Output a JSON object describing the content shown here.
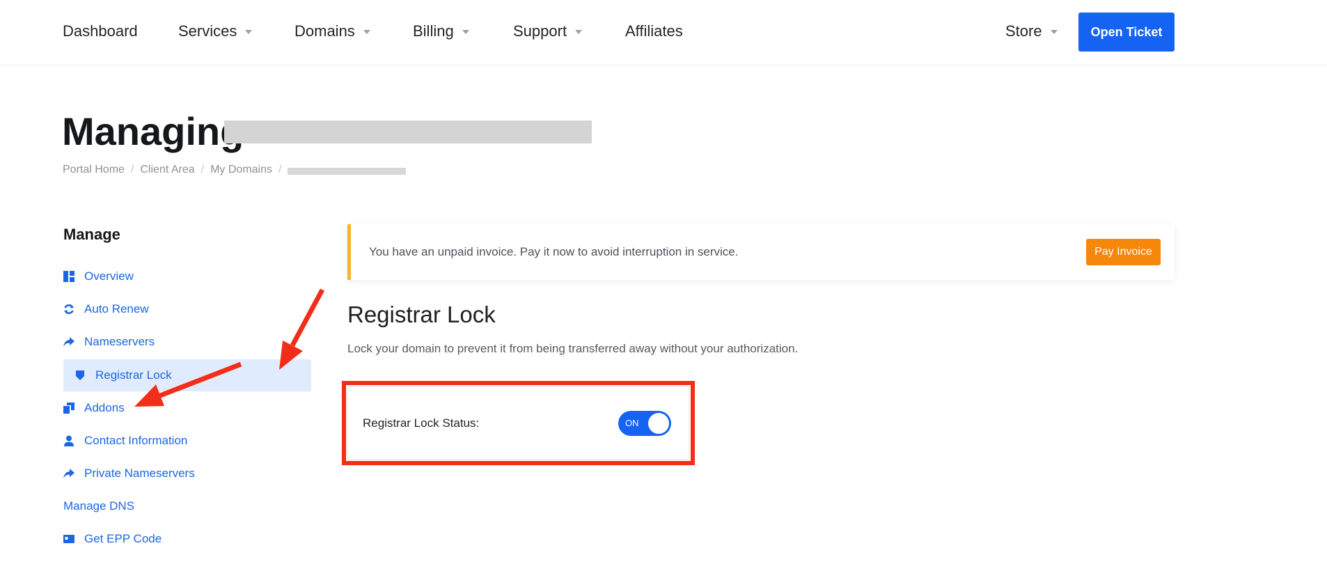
{
  "header": {
    "nav": [
      {
        "label": "Dashboard",
        "has_dropdown": false
      },
      {
        "label": "Services",
        "has_dropdown": true
      },
      {
        "label": "Domains",
        "has_dropdown": true
      },
      {
        "label": "Billing",
        "has_dropdown": true
      },
      {
        "label": "Support",
        "has_dropdown": true
      },
      {
        "label": "Affiliates",
        "has_dropdown": false
      }
    ],
    "store_label": "Store",
    "open_ticket_label": "Open Ticket"
  },
  "page": {
    "title_prefix": "Managing",
    "breadcrumb": [
      "Portal Home",
      "Client Area",
      "My Domains"
    ]
  },
  "sidebar": {
    "heading": "Manage",
    "items": [
      {
        "label": "Overview",
        "icon": "dashboard-icon",
        "active": false
      },
      {
        "label": "Auto Renew",
        "icon": "refresh-icon",
        "active": false
      },
      {
        "label": "Nameservers",
        "icon": "share-arrow-icon",
        "active": false
      },
      {
        "label": "Registrar Lock",
        "icon": "shield-icon",
        "active": true
      },
      {
        "label": "Addons",
        "icon": "clone-icon",
        "active": false
      },
      {
        "label": "Contact Information",
        "icon": "user-icon",
        "active": false
      },
      {
        "label": "Private Nameservers",
        "icon": "share-arrow-icon",
        "active": false
      },
      {
        "label": "Manage DNS",
        "icon": "",
        "active": false
      },
      {
        "label": "Get EPP Code",
        "icon": "id-card-icon",
        "active": false
      }
    ]
  },
  "alert": {
    "message": "You have an unpaid invoice. Pay it now to avoid interruption in service.",
    "button_label": "Pay Invoice"
  },
  "main": {
    "section_title": "Registrar Lock",
    "description": "Lock your domain to prevent it from being transferred away without your authorization.",
    "status_label": "Registrar Lock Status:",
    "toggle_text": "ON",
    "toggle_on": true
  },
  "colors": {
    "accent": "#1463f3",
    "link": "#1a66e3",
    "warning": "#f6b32c",
    "pay_button": "#f5870b",
    "annotation_red": "#f22d1a"
  }
}
